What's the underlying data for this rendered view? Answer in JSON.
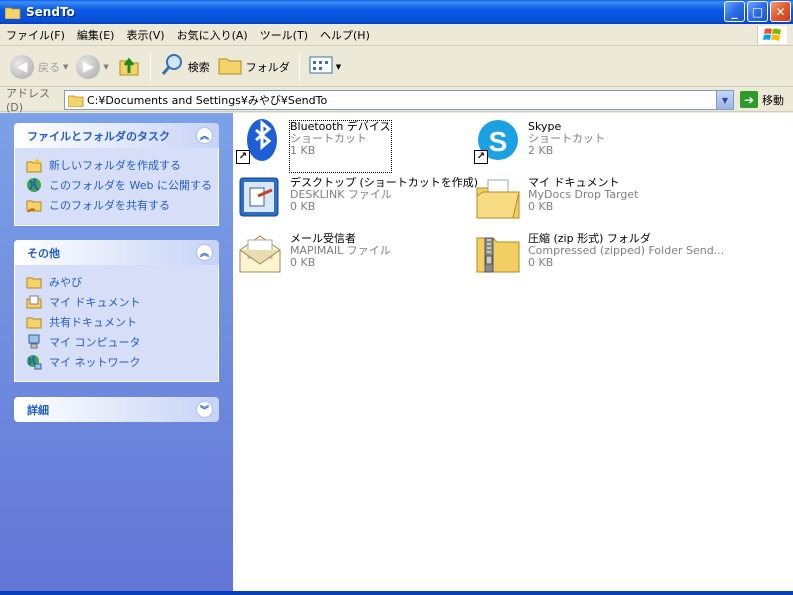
{
  "window": {
    "title": "SendTo"
  },
  "menu": [
    "ファイル(F)",
    "編集(E)",
    "表示(V)",
    "お気に入り(A)",
    "ツール(T)",
    "ヘルプ(H)"
  ],
  "toolbar": {
    "back": "戻る",
    "search": "検索",
    "folders": "フォルダ"
  },
  "address": {
    "label": "アドレス(D)",
    "path": "C:¥Documents and Settings¥みやび¥SendTo",
    "go": "移動"
  },
  "tasks_panel": {
    "title": "ファイルとフォルダのタスク",
    "items": [
      {
        "label": "新しいフォルダを作成する",
        "icon": "new-folder-icon"
      },
      {
        "label": "このフォルダを Web に公開する",
        "icon": "publish-web-icon"
      },
      {
        "label": "このフォルダを共有する",
        "icon": "share-folder-icon"
      }
    ]
  },
  "other_panel": {
    "title": "その他",
    "items": [
      {
        "label": "みやび",
        "icon": "folder-icon"
      },
      {
        "label": "マイ ドキュメント",
        "icon": "my-documents-icon"
      },
      {
        "label": "共有ドキュメント",
        "icon": "folder-icon"
      },
      {
        "label": "マイ コンピュータ",
        "icon": "my-computer-icon"
      },
      {
        "label": "マイ ネットワーク",
        "icon": "my-network-icon"
      }
    ]
  },
  "details_panel": {
    "title": "詳細"
  },
  "files": [
    {
      "name": "Bluetooth デバイス",
      "type": "ショートカット",
      "size": "1 KB",
      "icon": "bluetooth-icon",
      "shortcut": true,
      "selected": true
    },
    {
      "name": "Skype",
      "type": "ショートカット",
      "size": "2 KB",
      "icon": "skype-icon",
      "shortcut": true,
      "selected": false
    },
    {
      "name": "デスクトップ (ショートカットを作成)",
      "type": "DESKLINK ファイル",
      "size": "0 KB",
      "icon": "desktop-shortcut-icon",
      "shortcut": false,
      "selected": false
    },
    {
      "name": "マイ ドキュメント",
      "type": "MyDocs Drop Target",
      "size": "0 KB",
      "icon": "my-documents-folder-icon",
      "shortcut": false,
      "selected": false
    },
    {
      "name": "メール受信者",
      "type": "MAPIMAIL ファイル",
      "size": "0 KB",
      "icon": "mail-recipient-icon",
      "shortcut": false,
      "selected": false
    },
    {
      "name": "圧縮 (zip 形式) フォルダ",
      "type": "Compressed (zipped) Folder Send...",
      "size": "0 KB",
      "icon": "zip-folder-icon",
      "shortcut": false,
      "selected": false
    }
  ],
  "colors": {
    "title_bar": "#0550d6",
    "task_pane": "#6375d6",
    "link": "#215dc6"
  }
}
